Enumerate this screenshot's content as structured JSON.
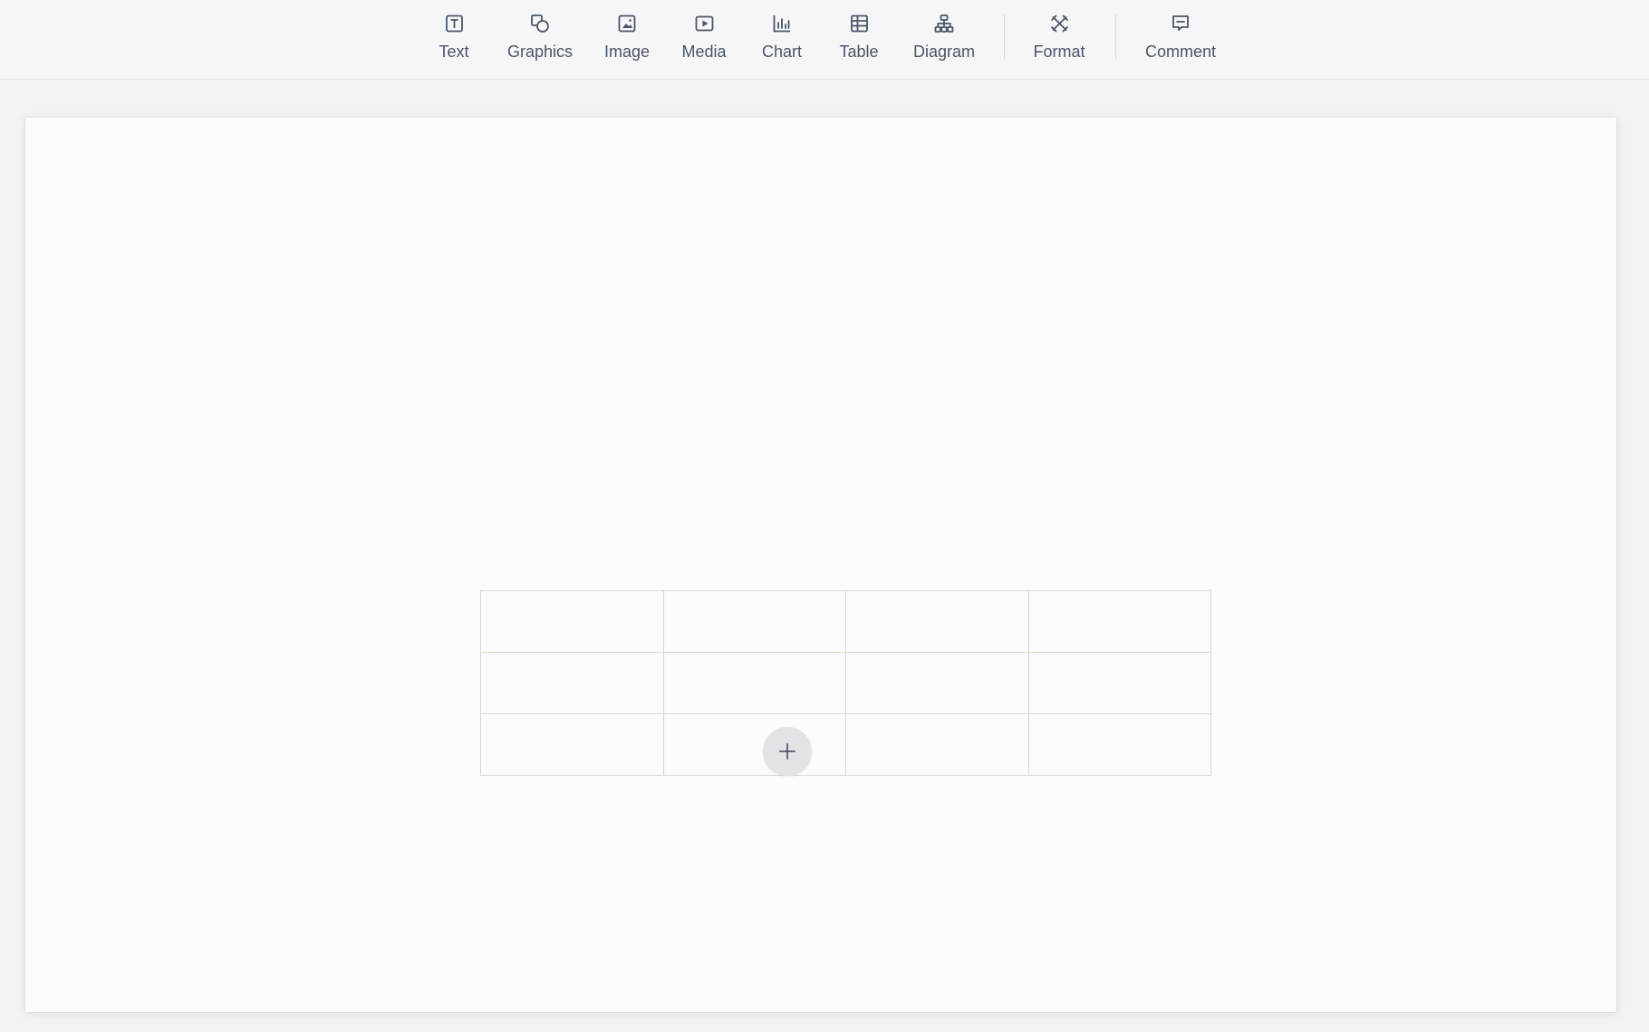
{
  "toolbar": {
    "items": [
      {
        "id": "text",
        "label": "Text",
        "icon": "text-box-icon"
      },
      {
        "id": "graphics",
        "label": "Graphics",
        "icon": "shapes-icon"
      },
      {
        "id": "image",
        "label": "Image",
        "icon": "image-icon"
      },
      {
        "id": "media",
        "label": "Media",
        "icon": "play-media-icon"
      },
      {
        "id": "chart",
        "label": "Chart",
        "icon": "bar-chart-icon"
      },
      {
        "id": "table",
        "label": "Table",
        "icon": "table-icon"
      },
      {
        "id": "diagram",
        "label": "Diagram",
        "icon": "hierarchy-icon"
      },
      {
        "id": "format",
        "label": "Format",
        "icon": "format-tools-icon"
      },
      {
        "id": "comment",
        "label": "Comment",
        "icon": "comment-icon"
      }
    ]
  },
  "slide": {
    "table": {
      "rows": [
        [
          "",
          "",
          "",
          ""
        ],
        [
          "",
          "",
          "",
          ""
        ],
        [
          "",
          "",
          "",
          ""
        ]
      ]
    },
    "add_button_icon": "plus-icon"
  },
  "colors": {
    "toolbar_bg": "#f5f6f8",
    "canvas_bg": "#f2f3f5",
    "slide_bg": "#fcfcfe",
    "icon_color": "#4b5563",
    "table_border": "#d6d8dc"
  }
}
